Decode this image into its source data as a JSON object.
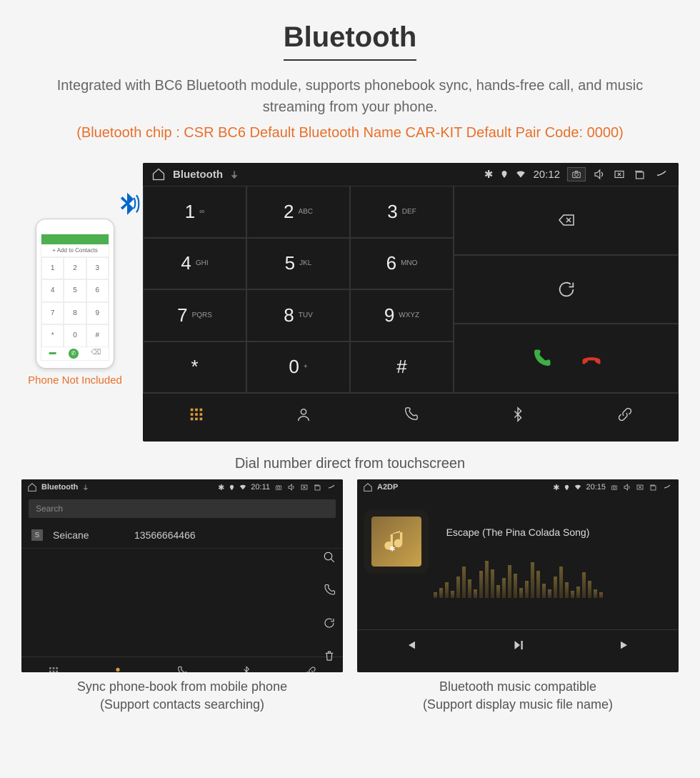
{
  "header": {
    "title": "Bluetooth",
    "subtitle": "Integrated with BC6 Bluetooth module, supports phonebook sync, hands-free call, and music streaming from your phone.",
    "specs": "(Bluetooth chip : CSR BC6     Default Bluetooth Name CAR-KIT     Default Pair Code: 0000)"
  },
  "phone": {
    "add_label": "+   Add to Contacts",
    "not_included": "Phone Not Included"
  },
  "dialer": {
    "status_title": "Bluetooth",
    "time": "20:12",
    "keys": [
      {
        "num": "1",
        "sub": "∞"
      },
      {
        "num": "2",
        "sub": "ABC"
      },
      {
        "num": "3",
        "sub": "DEF"
      },
      {
        "num": "4",
        "sub": "GHI"
      },
      {
        "num": "5",
        "sub": "JKL"
      },
      {
        "num": "6",
        "sub": "MNO"
      },
      {
        "num": "7",
        "sub": "PQRS"
      },
      {
        "num": "8",
        "sub": "TUV"
      },
      {
        "num": "9",
        "sub": "WXYZ"
      },
      {
        "num": "*",
        "sub": ""
      },
      {
        "num": "0",
        "sub": "+"
      },
      {
        "num": "#",
        "sub": ""
      }
    ],
    "caption": "Dial number direct from touchscreen"
  },
  "contacts": {
    "status_title": "Bluetooth",
    "time": "20:11",
    "search_placeholder": "Search",
    "rows": [
      {
        "badge": "S",
        "name": "Seicane",
        "number": "13566664466"
      }
    ],
    "caption_line1": "Sync phone-book from mobile phone",
    "caption_line2": "(Support contacts searching)"
  },
  "music": {
    "status_title": "A2DP",
    "time": "20:15",
    "track": "Escape (The Pina Colada Song)",
    "caption_line1": "Bluetooth music compatible",
    "caption_line2": "(Support display music file name)"
  }
}
